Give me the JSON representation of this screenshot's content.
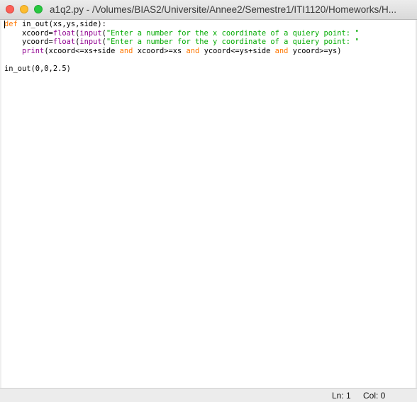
{
  "window": {
    "title": "a1q2.py - /Volumes/BIAS2/Universite/Annee2/Semestre1/ITI1120/Homeworks/H..."
  },
  "editor": {
    "lines": [
      [
        {
          "text": "def",
          "cls": "kw"
        },
        {
          "text": " in_out(xs,ys,side):",
          "cls": ""
        }
      ],
      [
        {
          "text": "    xcoord=",
          "cls": ""
        },
        {
          "text": "float",
          "cls": "bi"
        },
        {
          "text": "(",
          "cls": ""
        },
        {
          "text": "input",
          "cls": "bi"
        },
        {
          "text": "(",
          "cls": ""
        },
        {
          "text": "\"Enter a number for the x coordinate of a quiery point: \"",
          "cls": "str"
        }
      ],
      [
        {
          "text": "    ycoord=",
          "cls": ""
        },
        {
          "text": "float",
          "cls": "bi"
        },
        {
          "text": "(",
          "cls": ""
        },
        {
          "text": "input",
          "cls": "bi"
        },
        {
          "text": "(",
          "cls": ""
        },
        {
          "text": "\"Enter a number for the y coordinate of a quiery point: \"",
          "cls": "str"
        }
      ],
      [
        {
          "text": "    ",
          "cls": ""
        },
        {
          "text": "print",
          "cls": "bi"
        },
        {
          "text": "(xcoord<=xs+side ",
          "cls": ""
        },
        {
          "text": "and",
          "cls": "kw"
        },
        {
          "text": " xcoord>=xs ",
          "cls": ""
        },
        {
          "text": "and",
          "cls": "kw"
        },
        {
          "text": " ycoord<=ys+side ",
          "cls": ""
        },
        {
          "text": "and",
          "cls": "kw"
        },
        {
          "text": " ycoord>=ys)",
          "cls": ""
        }
      ],
      [],
      [
        {
          "text": "in_out(0,0,2.5)",
          "cls": ""
        }
      ]
    ]
  },
  "statusbar": {
    "line": "Ln: 1",
    "column": "Col: 0"
  },
  "colors": {
    "keyword": "#ff7700",
    "builtin": "#900090",
    "string": "#00aa00",
    "close_button": "#fc5f57",
    "minimize_button": "#fdbc2e",
    "zoom_button": "#28c840"
  },
  "icons": {
    "close": "close-icon",
    "minimize": "minimize-icon",
    "zoom": "zoom-icon"
  }
}
